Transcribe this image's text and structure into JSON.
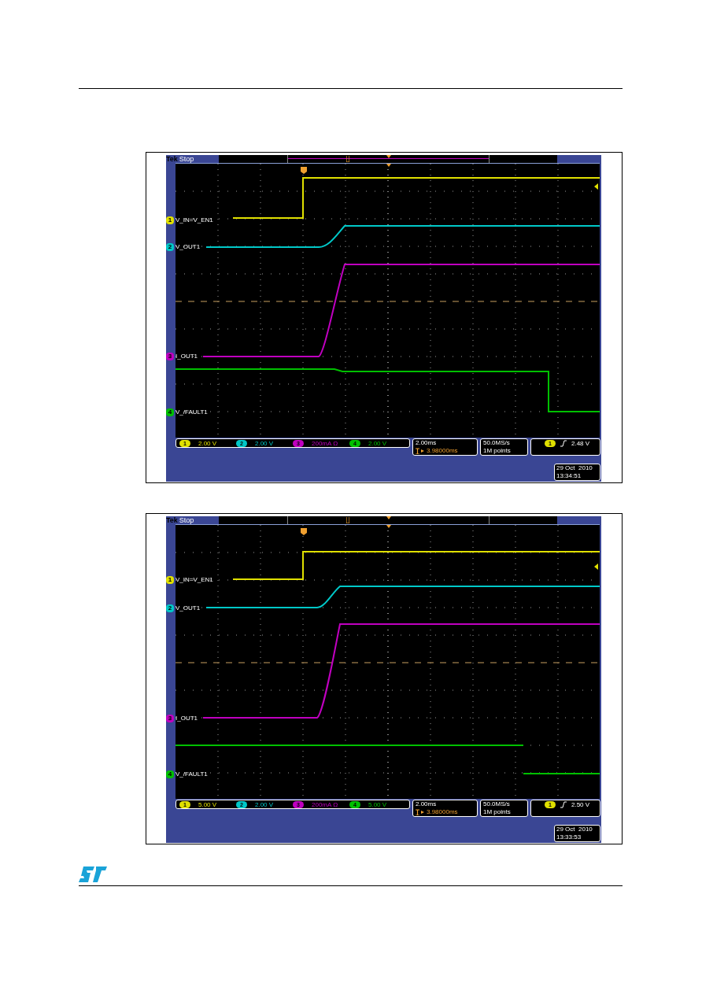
{
  "scopes": [
    {
      "brand": "Tek",
      "status": "Stop",
      "traces": [
        {
          "channel": "1",
          "label": "V_IN=V_EN1",
          "color": "#e0e000"
        },
        {
          "channel": "2",
          "label": "V_OUT1",
          "color": "#00c8c8"
        },
        {
          "channel": "3",
          "label": "I_OUT1",
          "color": "#c000c0"
        },
        {
          "channel": "4",
          "label": "V_/FAULT1",
          "color": "#00c000"
        }
      ],
      "readouts": {
        "channels": [
          {
            "channel": "1",
            "scale": "2.00 V",
            "color": "#e0e000"
          },
          {
            "channel": "2",
            "scale": "2.00 V",
            "color": "#00c8c8"
          },
          {
            "channel": "3",
            "scale": "200mA Ω",
            "color": "#c000c0"
          },
          {
            "channel": "4",
            "scale": "2.00 V",
            "color": "#00c000"
          }
        ],
        "timebase": "2.00ms",
        "position": "3.98000ms",
        "sample_rate": "50.0MS/s",
        "record_length": "1M points",
        "trigger": {
          "channel": "1",
          "level": "2.48 V"
        },
        "date": "29 Oct  2010",
        "time": "13:34:51"
      }
    },
    {
      "brand": "Tek",
      "status": "Stop",
      "traces": [
        {
          "channel": "1",
          "label": "V_IN=V_EN1",
          "color": "#e0e000"
        },
        {
          "channel": "2",
          "label": "V_OUT1",
          "color": "#00c8c8"
        },
        {
          "channel": "3",
          "label": "I_OUT1",
          "color": "#c000c0"
        },
        {
          "channel": "4",
          "label": "V_/FAULT1",
          "color": "#00c000"
        }
      ],
      "readouts": {
        "channels": [
          {
            "channel": "1",
            "scale": "5.00 V",
            "color": "#e0e000"
          },
          {
            "channel": "2",
            "scale": "2.00 V",
            "color": "#00c8c8"
          },
          {
            "channel": "3",
            "scale": "200mA Ω",
            "color": "#c000c0"
          },
          {
            "channel": "4",
            "scale": "5.00 V",
            "color": "#00c000"
          }
        ],
        "timebase": "2.00ms",
        "position": "3.98000ms",
        "sample_rate": "50.0MS/s",
        "record_length": "1M points",
        "trigger": {
          "channel": "1",
          "level": "2.50 V"
        },
        "date": "29 Oct  2010",
        "time": "13:33:53"
      }
    }
  ]
}
